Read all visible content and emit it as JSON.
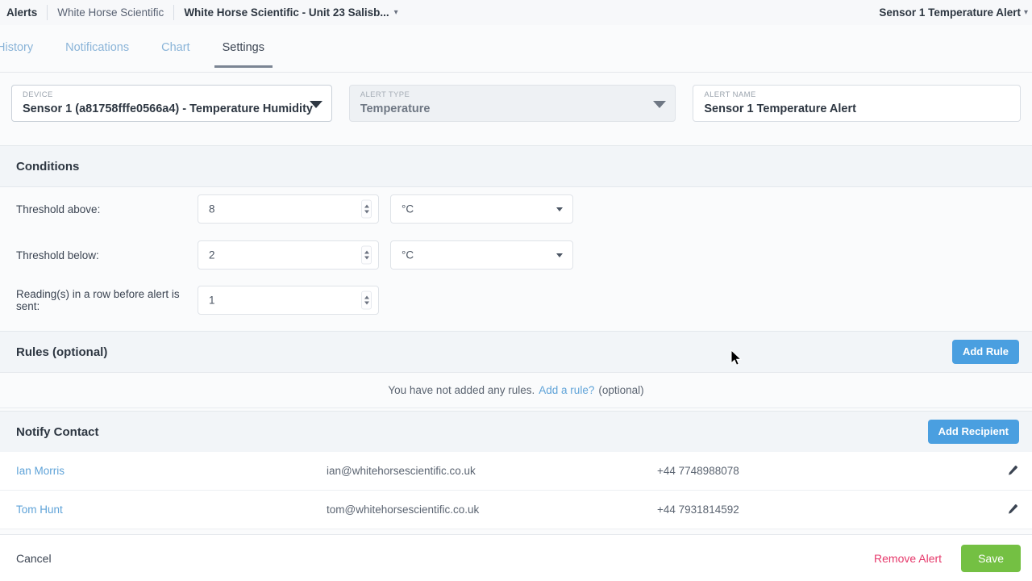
{
  "breadcrumb": {
    "items": [
      {
        "label": "Alerts",
        "strong": true
      },
      {
        "label": "White Horse Scientific",
        "strong": false
      },
      {
        "label": "White Horse Scientific - Unit 23 Salisb...",
        "strong": true
      }
    ],
    "caret_icon": "chevron-down-icon",
    "right_title": "Sensor 1 Temperature Alert",
    "right_caret_icon": "chevron-down-icon"
  },
  "tabs": [
    {
      "label": "History",
      "active": false
    },
    {
      "label": "Notifications",
      "active": false
    },
    {
      "label": "Chart",
      "active": false
    },
    {
      "label": "Settings",
      "active": true
    }
  ],
  "fields": {
    "device": {
      "label": "DEVICE",
      "value": "Sensor 1 (a81758fffe0566a4) - Temperature Humidity",
      "caret_icon": "caret-down-icon"
    },
    "alert_type": {
      "label": "ALERT TYPE",
      "value": "Temperature",
      "caret_icon": "caret-down-icon"
    },
    "alert_name": {
      "label": "ALERT NAME",
      "value": "Sensor 1 Temperature Alert"
    }
  },
  "conditions": {
    "title": "Conditions",
    "rows": [
      {
        "label": "Threshold above:",
        "value": "8",
        "unit": "°C",
        "has_unit": true
      },
      {
        "label": "Threshold below:",
        "value": "2",
        "unit": "°C",
        "has_unit": true
      },
      {
        "label": "Reading(s) in a row before alert is sent:",
        "value": "1",
        "unit": "",
        "has_unit": false
      }
    ]
  },
  "rules": {
    "title": "Rules (optional)",
    "add_button": "Add Rule",
    "empty_prefix": "You have not added any rules.",
    "empty_link": "Add a rule?",
    "empty_suffix": "(optional)"
  },
  "notify": {
    "title": "Notify Contact",
    "add_button": "Add Recipient",
    "contacts": [
      {
        "name": "Ian Morris",
        "email": "ian@whitehorsescientific.co.uk",
        "phone": "+44 7748988078",
        "edit_icon": "pencil-icon"
      },
      {
        "name": "Tom Hunt",
        "email": "tom@whitehorsescientific.co.uk",
        "phone": "+44 7931814592",
        "edit_icon": "pencil-icon"
      }
    ]
  },
  "footer": {
    "cancel": "Cancel",
    "remove": "Remove Alert",
    "save": "Save"
  },
  "colors": {
    "accent_blue": "#4a9fe0",
    "save_green": "#74c043",
    "remove_pink": "#e6396b",
    "link_blue": "#5fa3d8",
    "tab_inactive": "#8ab4d8",
    "section_bg": "#f2f5f8"
  }
}
